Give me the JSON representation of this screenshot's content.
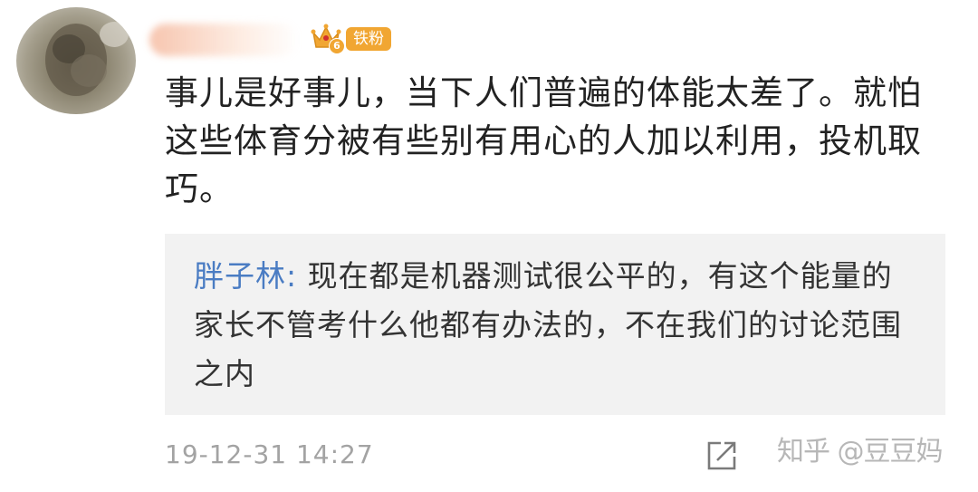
{
  "comment": {
    "badge_label": "铁粉",
    "badge_level": "6",
    "text": "事儿是好事儿，当下人们普遍的体能太差了。就怕这些体育分被有些别有用心的人加以利用，投机取巧。",
    "reply": {
      "author": "胖子林:",
      "text": " 现在都是机器测试很公平的，有这个能量的家长不管考什么他都有办法的，不在我们的讨论范围之内"
    },
    "timestamp": "19-12-31 14:27"
  },
  "icons": {
    "avatar": "user-avatar-photo",
    "badge": "crown-icon",
    "share": "share-icon"
  },
  "watermark": "知乎 @豆豆妈",
  "colors": {
    "badge": "#f1a632",
    "reply_author": "#4a7cc3",
    "reply_background": "#f2f2f2",
    "timestamp": "#a3a3a3",
    "text": "#222222"
  }
}
